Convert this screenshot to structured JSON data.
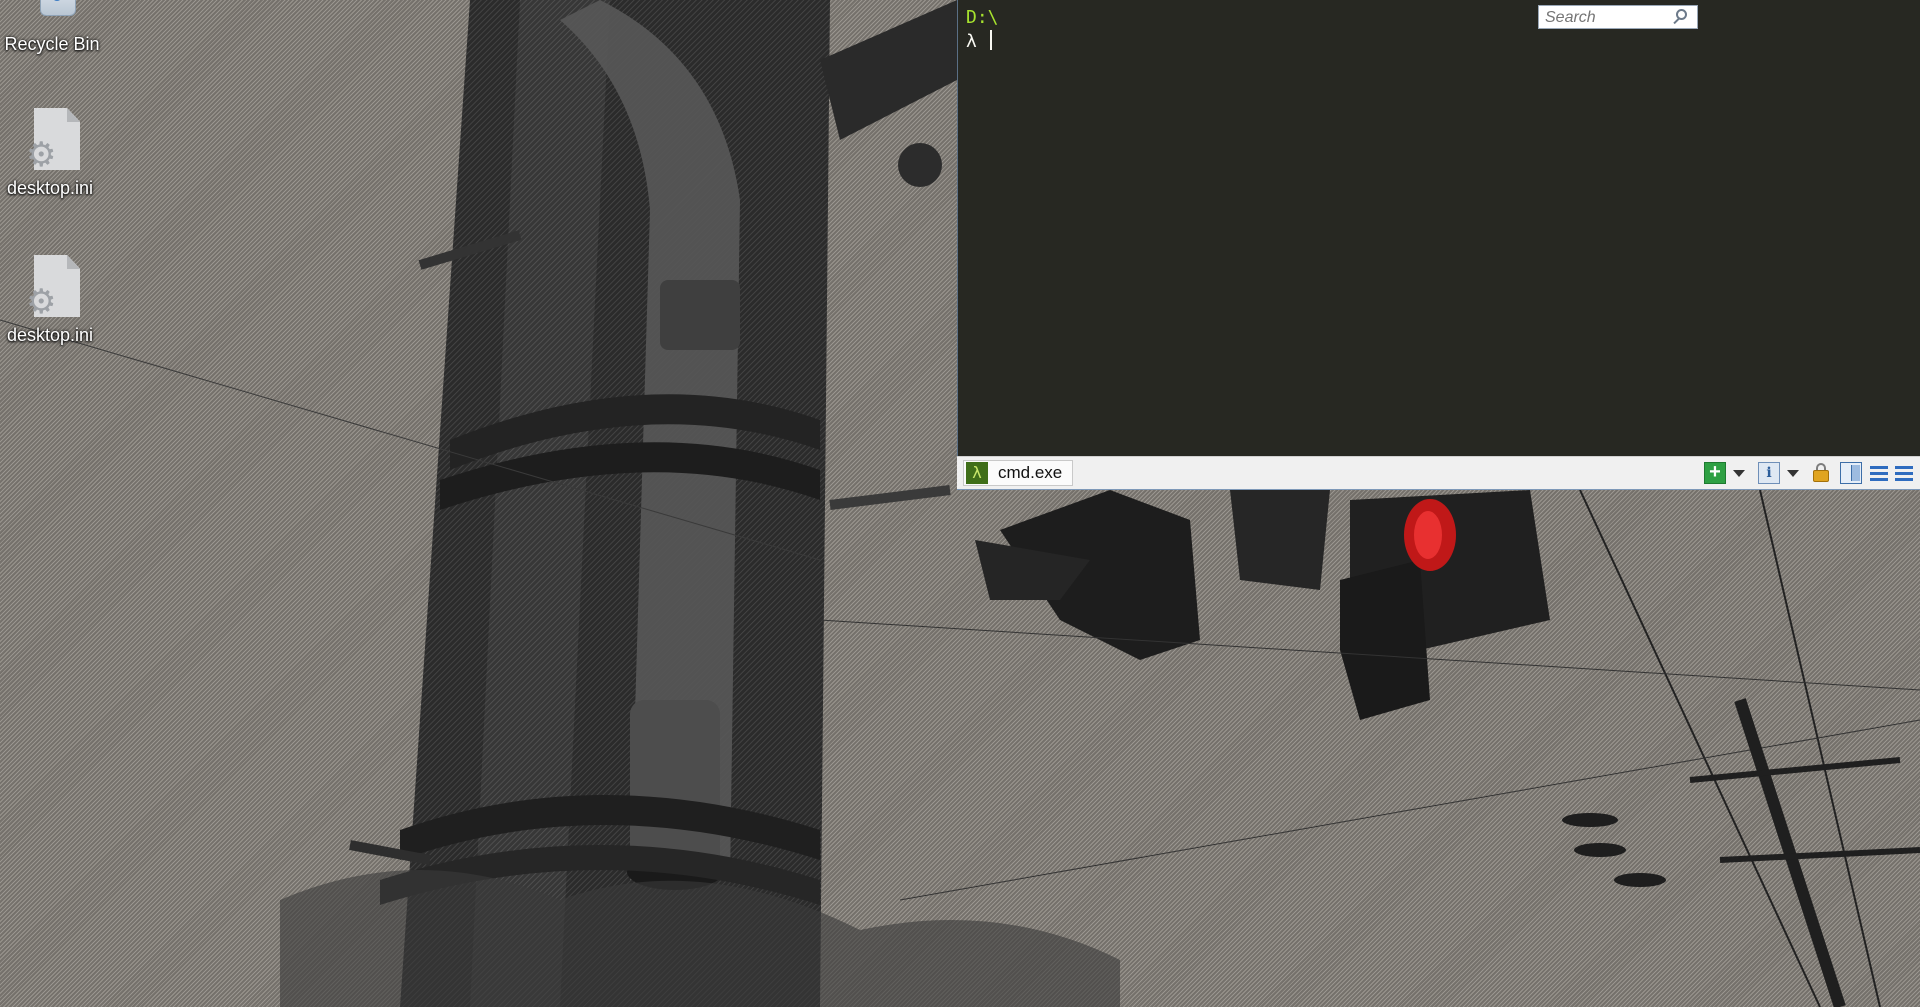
{
  "desktop": {
    "icons": [
      {
        "label": "Recycle Bin",
        "icon": "recycle-bin-icon"
      },
      {
        "label": "desktop.ini",
        "icon": "settings-file-icon"
      },
      {
        "label": "desktop.ini",
        "icon": "settings-file-icon"
      }
    ]
  },
  "terminal": {
    "path": "D:\\",
    "prompt": "λ ",
    "background": "#272822",
    "path_color": "#a6e22e",
    "statusbar": {
      "tab_badge": "λ",
      "tab_label": "cmd.exe",
      "search_placeholder": "Search",
      "buttons": {
        "new_console": "+",
        "info": "i"
      },
      "icons": [
        "lambda-icon",
        "search-icon",
        "add-console-icon",
        "dropdown-arrow-icon",
        "info-icon",
        "lock-icon",
        "split-view-icon",
        "menu-icon"
      ]
    }
  }
}
